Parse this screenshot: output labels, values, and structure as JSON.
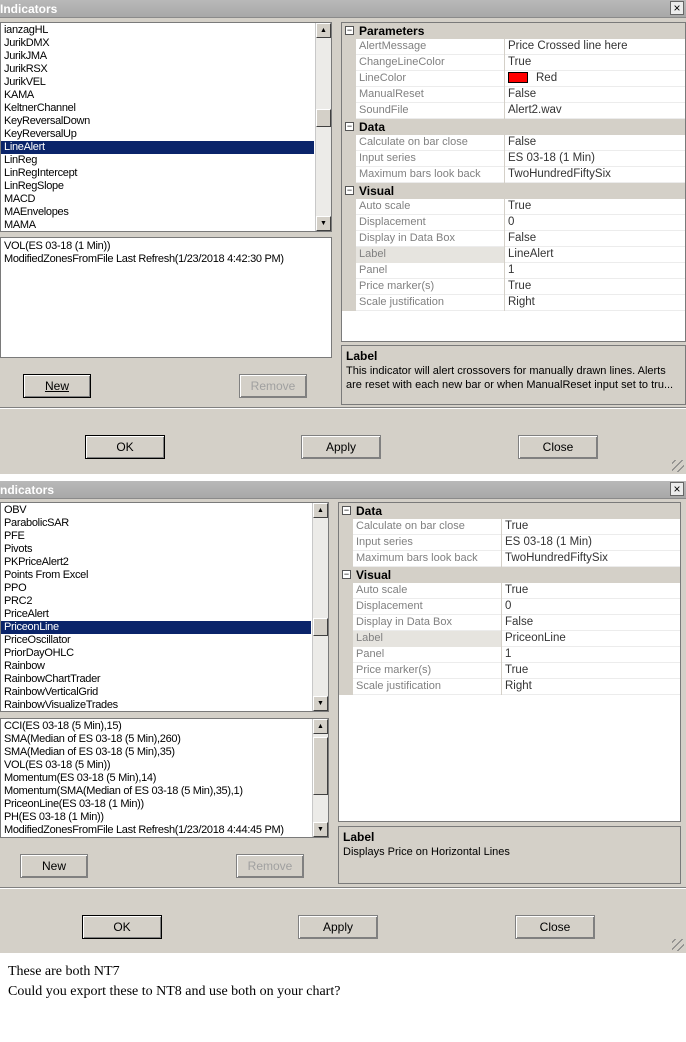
{
  "dialog1": {
    "title": "Indicators",
    "close_glyph": "×",
    "list_items": [
      "ianzagHL",
      "JurikDMX",
      "JurikJMA",
      "JurikRSX",
      "JurikVEL",
      "KAMA",
      "KeltnerChannel",
      "KeyReversalDown",
      "KeyReversalUp",
      "LineAlert",
      "LinReg",
      "LinRegIntercept",
      "LinRegSlope",
      "MACD",
      "MAEnvelopes",
      "MAMA"
    ],
    "selected_item": "LineAlert",
    "applied": [
      "VOL(ES 03-18 (1 Min))",
      "ModifiedZonesFromFile Last Refresh(1/23/2018 4:42:30 PM)"
    ],
    "new_label": "New",
    "remove_label": "Remove",
    "categories": [
      {
        "name": "Parameters",
        "toggle": "⊟",
        "props": [
          {
            "name": "AlertMessage",
            "value": "Price Crossed line here"
          },
          {
            "name": "ChangeLineColor",
            "value": "True"
          },
          {
            "name": "LineColor",
            "value": "Red",
            "swatch": "#ff0000"
          },
          {
            "name": "ManualReset",
            "value": "False"
          },
          {
            "name": "SoundFile",
            "value": "Alert2.wav"
          }
        ]
      },
      {
        "name": "Data",
        "toggle": "⊟",
        "props": [
          {
            "name": "Calculate on bar close",
            "value": "False"
          },
          {
            "name": "Input series",
            "value": "ES 03-18 (1 Min)"
          },
          {
            "name": "Maximum bars look back",
            "value": "TwoHundredFiftySix"
          }
        ]
      },
      {
        "name": "Visual",
        "toggle": "⊟",
        "props": [
          {
            "name": "Auto scale",
            "value": "True"
          },
          {
            "name": "Displacement",
            "value": "0"
          },
          {
            "name": "Display in Data Box",
            "value": "False"
          },
          {
            "name": "Label",
            "value": "LineAlert"
          },
          {
            "name": "Panel",
            "value": "1"
          },
          {
            "name": "Price marker(s)",
            "value": "True"
          },
          {
            "name": "Scale justification",
            "value": "Right"
          }
        ]
      }
    ],
    "desc_title": "Label",
    "desc_text": "This indicator will alert crossovers for manually drawn lines. Alerts are reset with each new bar or when ManualReset input set to tru...",
    "ok_label": "OK",
    "apply_label": "Apply",
    "close_label": "Close"
  },
  "dialog2": {
    "title": "ndicators",
    "close_glyph": "×",
    "list_items": [
      "OBV",
      "ParabolicSAR",
      "PFE",
      "Pivots",
      "PKPriceAlert2",
      "Points From Excel",
      "PPO",
      "PRC2",
      "PriceAlert",
      "PriceonLine",
      "PriceOscillator",
      "PriorDayOHLC",
      "Rainbow",
      "RainbowChartTrader",
      "RainbowVerticalGrid",
      "RainbowVisualizeTrades"
    ],
    "selected_item": "PriceonLine",
    "applied": [
      "CCI(ES 03-18 (5 Min),15)",
      "SMA(Median of ES 03-18 (5 Min),260)",
      "SMA(Median of ES 03-18 (5 Min),35)",
      "VOL(ES 03-18 (5 Min))",
      "Momentum(ES 03-18 (5 Min),14)",
      "Momentum(SMA(Median of ES 03-18 (5 Min),35),1)",
      "PriceonLine(ES 03-18 (1 Min))",
      "PH(ES 03-18 (1 Min))",
      "ModifiedZonesFromFile Last Refresh(1/23/2018 4:44:45 PM)"
    ],
    "new_label": "New",
    "remove_label": "Remove",
    "categories": [
      {
        "name": "Data",
        "toggle": "⊟",
        "props": [
          {
            "name": "Calculate on bar close",
            "value": "True"
          },
          {
            "name": "Input series",
            "value": "ES 03-18 (1 Min)"
          },
          {
            "name": "Maximum bars look back",
            "value": "TwoHundredFiftySix"
          }
        ]
      },
      {
        "name": "Visual",
        "toggle": "⊟",
        "props": [
          {
            "name": "Auto scale",
            "value": "True"
          },
          {
            "name": "Displacement",
            "value": "0"
          },
          {
            "name": "Display in Data Box",
            "value": "False"
          },
          {
            "name": "Label",
            "value": "PriceonLine"
          },
          {
            "name": "Panel",
            "value": "1"
          },
          {
            "name": "Price marker(s)",
            "value": "True"
          },
          {
            "name": "Scale justification",
            "value": "Right"
          }
        ]
      }
    ],
    "desc_title": "Label",
    "desc_text": "Displays Price on Horizontal Lines",
    "ok_label": "OK",
    "apply_label": "Apply",
    "close_label": "Close"
  },
  "caption": {
    "line1": "These are both NT7",
    "line2": "Could you export these to NT8  and use both on your chart?"
  }
}
